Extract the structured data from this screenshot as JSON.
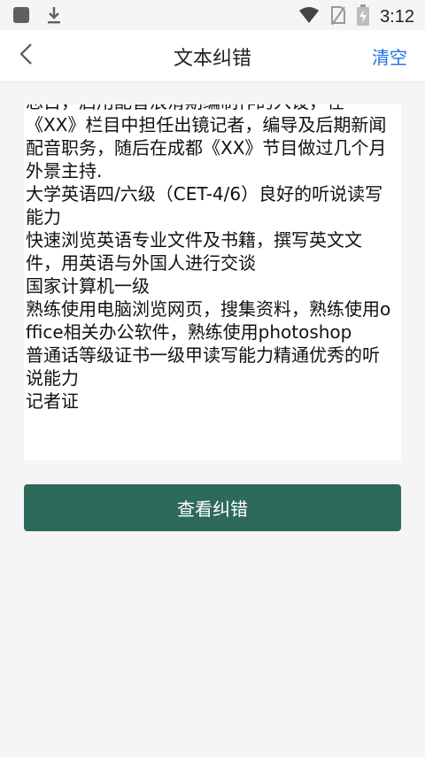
{
  "status_bar": {
    "time": "3:12",
    "icons": [
      "app-square-icon",
      "download-icon",
      "wifi-icon",
      "no-sim-icon",
      "battery-charging-icon"
    ]
  },
  "nav": {
    "title": "文本纠错",
    "clear_label": "清空",
    "back_icon": "chevron-left-icon"
  },
  "text_area": {
    "content": "忘目，启用配音浪滑期编制作的入设，在\n《XX》栏目中担任出镜记者，编导及后期新闻配音职务，随后在成都《XX》节目做过几个月外景主持.\n大学英语四/六级（CET-4/6）良好的听说读写能力\n快速浏览英语专业文件及书籍，撰写英文文件，用英语与外国人进行交谈\n国家计算机一级\n熟练使用电脑浏览网页，搜集资料，熟练使用office相关办公软件，熟练使用photoshop\n普通话等级证书一级甲读写能力精通优秀的听说能力\n记者证"
  },
  "actions": {
    "check_label": "查看纠错"
  },
  "colors": {
    "accent_blue": "#1f73e0",
    "button_green": "#2d6a5b",
    "background": "#f5f5f5"
  }
}
